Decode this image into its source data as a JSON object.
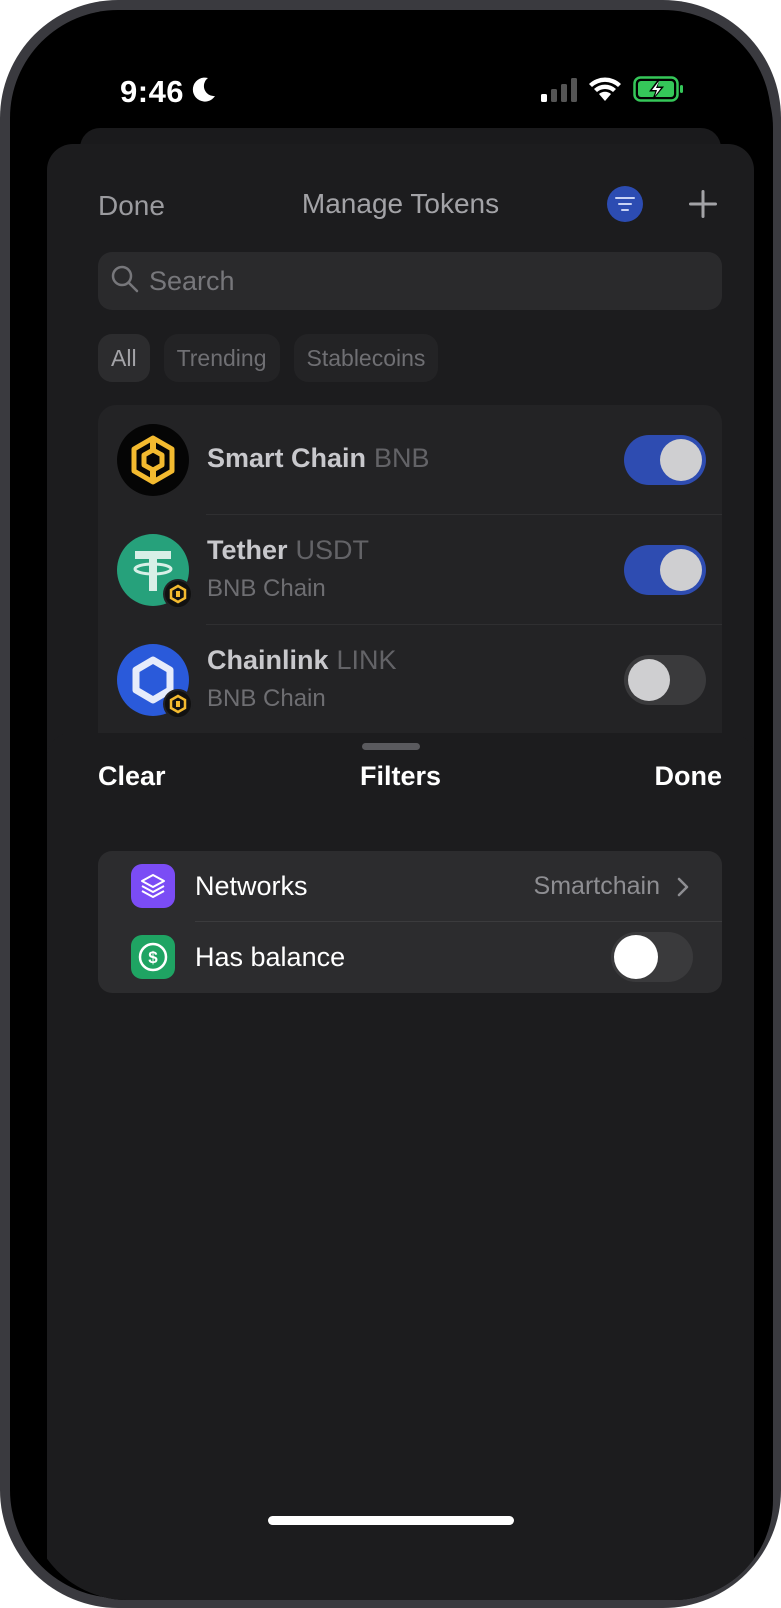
{
  "status_bar": {
    "time": "9:46",
    "icons": [
      "moon-icon",
      "signal-icon",
      "wifi-icon",
      "battery-charging-icon"
    ]
  },
  "manage_tokens": {
    "done_label": "Done",
    "title": "Manage Tokens",
    "filter_button_color": "#2c4cb2",
    "search_placeholder": "Search",
    "chips": [
      {
        "label": "All",
        "active": true
      },
      {
        "label": "Trending",
        "active": false
      },
      {
        "label": "Stablecoins",
        "active": false
      }
    ],
    "tokens": [
      {
        "name": "Smart Chain",
        "symbol": "BNB",
        "network": "",
        "logo": "bnb-logo-icon",
        "enabled": true
      },
      {
        "name": "Tether",
        "symbol": "USDT",
        "network": "BNB Chain",
        "logo": "tether-logo-icon",
        "enabled": true
      },
      {
        "name": "Chainlink",
        "symbol": "LINK",
        "network": "BNB Chain",
        "logo": "chainlink-logo-icon",
        "enabled": false
      }
    ]
  },
  "filters": {
    "clear_label": "Clear",
    "title": "Filters",
    "done_label": "Done",
    "rows": [
      {
        "label": "Networks",
        "value": "Smartchain",
        "icon": "layers-icon",
        "icon_color": "#7b4cf5"
      },
      {
        "label": "Has balance",
        "value": "",
        "icon": "dollar-icon",
        "icon_color": "#1fa463",
        "toggle_on": false
      }
    ]
  },
  "colors": {
    "accent": "#2e4cb1",
    "bnb_gold": "#f3ba2f",
    "tether_green": "#26a17b",
    "chainlink_blue": "#2a5ada"
  }
}
